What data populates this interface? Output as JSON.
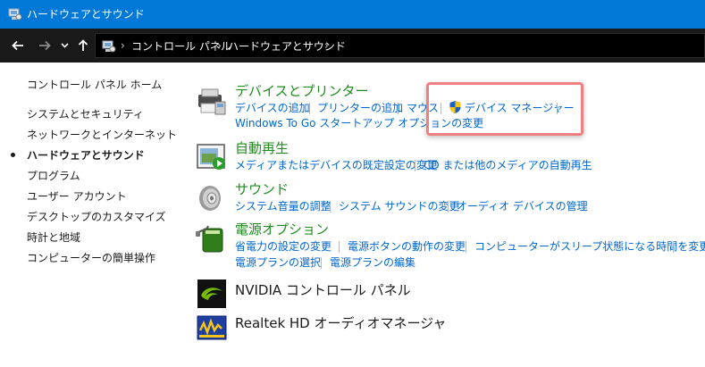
{
  "window": {
    "title": "ハードウェアとサウンド"
  },
  "nav": {
    "back_icon": "arrow-left-icon",
    "forward_icon": "arrow-right-icon",
    "recent_icon": "chevron-down-icon",
    "up_icon": "arrow-up-icon"
  },
  "breadcrumb": [
    "コントロール パネル",
    "ハードウェアとサウンド"
  ],
  "sidebar": {
    "items": [
      "コントロール パネル ホーム",
      "システムとセキュリティ",
      "ネットワークとインターネット",
      "ハードウェアとサウンド",
      "プログラム",
      "ユーザー アカウント",
      "デスクトップのカスタマイズ",
      "時計と地域",
      "コンピューターの簡単操作"
    ],
    "current_index": 3
  },
  "categories": {
    "devices": {
      "title": "デバイスとプリンター",
      "links": [
        "デバイスの追加",
        "プリンターの追加",
        "マウス",
        "デバイス マネージャー",
        "Windows To Go スタートアップ オプションの変更"
      ]
    },
    "autoplay": {
      "title": "自動再生",
      "links": [
        "メディアまたはデバイスの既定設定の変更",
        "CD または他のメディアの自動再生"
      ]
    },
    "sound": {
      "title": "サウンド",
      "links": [
        "システム音量の調整",
        "システム サウンドの変更",
        "オーディオ デバイスの管理"
      ]
    },
    "power": {
      "title": "電源オプション",
      "links": [
        "省電力の設定の変更",
        "電源ボタンの動作の変更",
        "コンピューターがスリープ状態になる時間を変更",
        "電源プランの選択",
        "電源プランの編集"
      ]
    },
    "nvidia": {
      "title": "NVIDIA コントロール パネル"
    },
    "realtek": {
      "title": "Realtek HD オーディオマネージャ"
    }
  },
  "colors": {
    "titlebar": "#0078d7",
    "navbar": "#191919",
    "category_title": "#1e8c1e",
    "link": "#0066cc",
    "highlight": "#f08080"
  }
}
